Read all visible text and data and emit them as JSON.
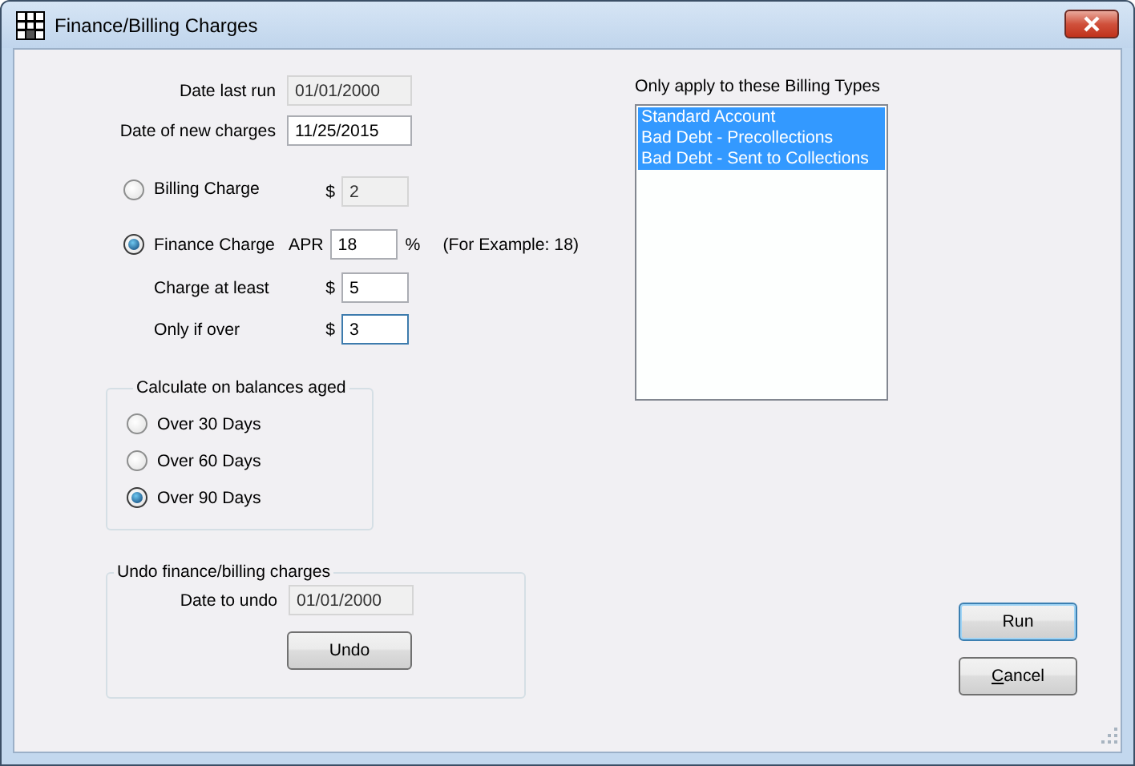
{
  "window": {
    "title": "Finance/Billing Charges"
  },
  "dates": [
    {
      "label": "Date last run",
      "value": "01/01/2000",
      "disabled": true
    },
    {
      "label": "Date of new charges",
      "value": "11/25/2015",
      "disabled": false
    }
  ],
  "charge_types": [
    {
      "label": "Billing Charge",
      "selected": false,
      "prefix": "$",
      "value": "2",
      "disabled": true
    },
    {
      "label": "Finance Charge",
      "selected": true,
      "prefix": "APR",
      "value": "18",
      "suffix": "%",
      "note": "(For Example: 18)",
      "disabled": false
    }
  ],
  "finance_options": [
    {
      "label": "Charge at least",
      "prefix": "$",
      "value": "5",
      "focused": false
    },
    {
      "label": "Only if over",
      "prefix": "$",
      "value": "3",
      "focused": true
    }
  ],
  "aging": {
    "title": "Calculate on balances aged",
    "options": [
      {
        "label": "Over 30 Days",
        "selected": false
      },
      {
        "label": "Over 60 Days",
        "selected": false
      },
      {
        "label": "Over 90 Days",
        "selected": true
      }
    ]
  },
  "undo": {
    "title": "Undo finance/billing charges",
    "date_label": "Date to undo",
    "date_value": "01/01/2000",
    "date_disabled": true,
    "button": "Undo"
  },
  "billing_types": {
    "title": "Only apply to these Billing Types",
    "items": [
      {
        "label": "Standard Account",
        "selected": true
      },
      {
        "label": "Bad Debt - Precollections",
        "selected": true
      },
      {
        "label": "Bad Debt - Sent to Collections",
        "selected": true
      }
    ]
  },
  "buttons": [
    {
      "label": "Run",
      "default": true
    },
    {
      "label": "Cancel",
      "default": false,
      "first_letter_underlined": true
    }
  ]
}
